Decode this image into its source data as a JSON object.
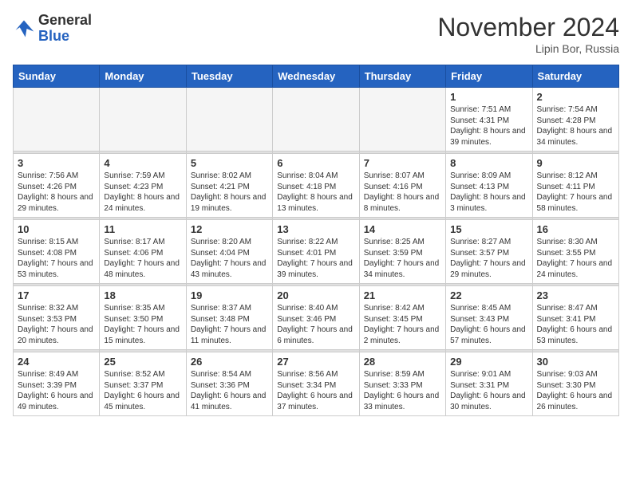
{
  "header": {
    "logo_general": "General",
    "logo_blue": "Blue",
    "month_title": "November 2024",
    "location": "Lipin Bor, Russia"
  },
  "weekdays": [
    "Sunday",
    "Monday",
    "Tuesday",
    "Wednesday",
    "Thursday",
    "Friday",
    "Saturday"
  ],
  "weeks": [
    [
      {
        "day": "",
        "info": ""
      },
      {
        "day": "",
        "info": ""
      },
      {
        "day": "",
        "info": ""
      },
      {
        "day": "",
        "info": ""
      },
      {
        "day": "",
        "info": ""
      },
      {
        "day": "1",
        "info": "Sunrise: 7:51 AM\nSunset: 4:31 PM\nDaylight: 8 hours and 39 minutes."
      },
      {
        "day": "2",
        "info": "Sunrise: 7:54 AM\nSunset: 4:28 PM\nDaylight: 8 hours and 34 minutes."
      }
    ],
    [
      {
        "day": "3",
        "info": "Sunrise: 7:56 AM\nSunset: 4:26 PM\nDaylight: 8 hours and 29 minutes."
      },
      {
        "day": "4",
        "info": "Sunrise: 7:59 AM\nSunset: 4:23 PM\nDaylight: 8 hours and 24 minutes."
      },
      {
        "day": "5",
        "info": "Sunrise: 8:02 AM\nSunset: 4:21 PM\nDaylight: 8 hours and 19 minutes."
      },
      {
        "day": "6",
        "info": "Sunrise: 8:04 AM\nSunset: 4:18 PM\nDaylight: 8 hours and 13 minutes."
      },
      {
        "day": "7",
        "info": "Sunrise: 8:07 AM\nSunset: 4:16 PM\nDaylight: 8 hours and 8 minutes."
      },
      {
        "day": "8",
        "info": "Sunrise: 8:09 AM\nSunset: 4:13 PM\nDaylight: 8 hours and 3 minutes."
      },
      {
        "day": "9",
        "info": "Sunrise: 8:12 AM\nSunset: 4:11 PM\nDaylight: 7 hours and 58 minutes."
      }
    ],
    [
      {
        "day": "10",
        "info": "Sunrise: 8:15 AM\nSunset: 4:08 PM\nDaylight: 7 hours and 53 minutes."
      },
      {
        "day": "11",
        "info": "Sunrise: 8:17 AM\nSunset: 4:06 PM\nDaylight: 7 hours and 48 minutes."
      },
      {
        "day": "12",
        "info": "Sunrise: 8:20 AM\nSunset: 4:04 PM\nDaylight: 7 hours and 43 minutes."
      },
      {
        "day": "13",
        "info": "Sunrise: 8:22 AM\nSunset: 4:01 PM\nDaylight: 7 hours and 39 minutes."
      },
      {
        "day": "14",
        "info": "Sunrise: 8:25 AM\nSunset: 3:59 PM\nDaylight: 7 hours and 34 minutes."
      },
      {
        "day": "15",
        "info": "Sunrise: 8:27 AM\nSunset: 3:57 PM\nDaylight: 7 hours and 29 minutes."
      },
      {
        "day": "16",
        "info": "Sunrise: 8:30 AM\nSunset: 3:55 PM\nDaylight: 7 hours and 24 minutes."
      }
    ],
    [
      {
        "day": "17",
        "info": "Sunrise: 8:32 AM\nSunset: 3:53 PM\nDaylight: 7 hours and 20 minutes."
      },
      {
        "day": "18",
        "info": "Sunrise: 8:35 AM\nSunset: 3:50 PM\nDaylight: 7 hours and 15 minutes."
      },
      {
        "day": "19",
        "info": "Sunrise: 8:37 AM\nSunset: 3:48 PM\nDaylight: 7 hours and 11 minutes."
      },
      {
        "day": "20",
        "info": "Sunrise: 8:40 AM\nSunset: 3:46 PM\nDaylight: 7 hours and 6 minutes."
      },
      {
        "day": "21",
        "info": "Sunrise: 8:42 AM\nSunset: 3:45 PM\nDaylight: 7 hours and 2 minutes."
      },
      {
        "day": "22",
        "info": "Sunrise: 8:45 AM\nSunset: 3:43 PM\nDaylight: 6 hours and 57 minutes."
      },
      {
        "day": "23",
        "info": "Sunrise: 8:47 AM\nSunset: 3:41 PM\nDaylight: 6 hours and 53 minutes."
      }
    ],
    [
      {
        "day": "24",
        "info": "Sunrise: 8:49 AM\nSunset: 3:39 PM\nDaylight: 6 hours and 49 minutes."
      },
      {
        "day": "25",
        "info": "Sunrise: 8:52 AM\nSunset: 3:37 PM\nDaylight: 6 hours and 45 minutes."
      },
      {
        "day": "26",
        "info": "Sunrise: 8:54 AM\nSunset: 3:36 PM\nDaylight: 6 hours and 41 minutes."
      },
      {
        "day": "27",
        "info": "Sunrise: 8:56 AM\nSunset: 3:34 PM\nDaylight: 6 hours and 37 minutes."
      },
      {
        "day": "28",
        "info": "Sunrise: 8:59 AM\nSunset: 3:33 PM\nDaylight: 6 hours and 33 minutes."
      },
      {
        "day": "29",
        "info": "Sunrise: 9:01 AM\nSunset: 3:31 PM\nDaylight: 6 hours and 30 minutes."
      },
      {
        "day": "30",
        "info": "Sunrise: 9:03 AM\nSunset: 3:30 PM\nDaylight: 6 hours and 26 minutes."
      }
    ]
  ]
}
